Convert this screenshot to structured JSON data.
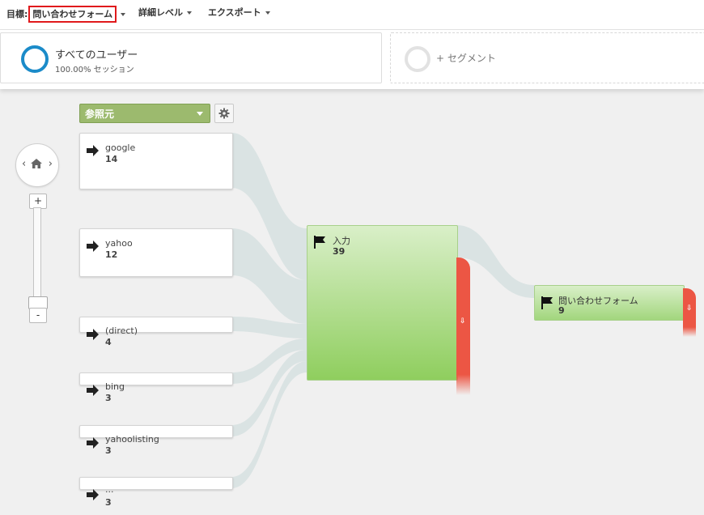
{
  "toolbar": {
    "goal_label": "目標:",
    "goal_value": "問い合わせフォーム",
    "detail_label": "詳細レベル",
    "export_label": "エクスポート"
  },
  "segment": {
    "title": "すべてのユーザー",
    "subtitle": "100.00% セッション",
    "ring_color": "#1b8bc9",
    "add_label": "+ セグメント"
  },
  "dimension": {
    "label": "参照元"
  },
  "zoom": {
    "plus": "+",
    "minus": "-",
    "level": 0.1
  },
  "home": {
    "left_arrow": "‹",
    "right_arrow": "›"
  },
  "sources": [
    {
      "name": "google",
      "count": "14"
    },
    {
      "name": "yahoo",
      "count": "12"
    },
    {
      "name": "(direct)",
      "count": "4"
    },
    {
      "name": "bing",
      "count": "3"
    },
    {
      "name": "yahoolisting",
      "count": "3"
    },
    {
      "name": "...",
      "count": "3"
    }
  ],
  "entry_node": {
    "name": "入力",
    "count": "39"
  },
  "goal_node": {
    "name": "問い合わせフォーム",
    "count": "9"
  },
  "dropoff": {
    "icon": "⇩",
    "color": "#ec5644"
  },
  "colors": {
    "node_green": "#a2d67d",
    "flow": "#d8e2e2",
    "dimension_bg": "#9cba6e"
  },
  "icons": {
    "source": "arrow-right-icon",
    "goal": "flag-icon",
    "settings": "gear-icon",
    "home": "home-icon"
  }
}
